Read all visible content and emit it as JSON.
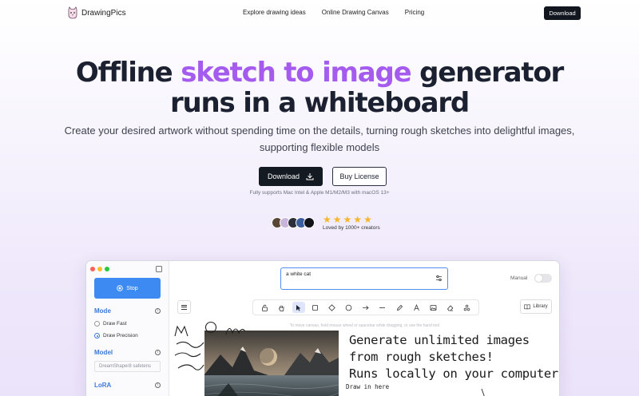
{
  "nav": {
    "brand": "DrawingPics",
    "links": [
      "Explore drawing ideas",
      "Online Drawing Canvas",
      "Pricing"
    ],
    "download": "Download"
  },
  "hero": {
    "title_pre": "Offline ",
    "title_accent": "sketch to image",
    "title_post": " generator",
    "title_line2": "runs in a whiteboard",
    "subtitle_line1": "Create your desired artwork without spending time on the details, turning rough sketches into delightful images,",
    "subtitle_line2": "supporting flexible models",
    "download": "Download",
    "buy": "Buy License",
    "support": "Fully supports Mac Intel & Apple M1/M2/M3 with macOS 13+",
    "loved": "Loved by 1000+ creators",
    "stars": 5,
    "accent_color": "#a45bee"
  },
  "app": {
    "stop": "Stop",
    "mode_label": "Mode",
    "mode_options": [
      "Draw Fast",
      "Draw Precision"
    ],
    "mode_selected": "Draw Precision",
    "model_label": "Model",
    "model_value": "DreamShaper8 safetens",
    "lora_label": "LoRA",
    "prompt": "a white cat",
    "manual_label": "Manual",
    "library": "Library",
    "hint": "To move canvas, hold mouse wheel or spacebar while dragging, or use the hand tool",
    "handwriting": [
      "Generate unlimited images",
      "from rough sketches!",
      "Runs locally on your computer!"
    ],
    "draw_here": "Draw in here",
    "accent_blue": "#3d8bf2"
  }
}
